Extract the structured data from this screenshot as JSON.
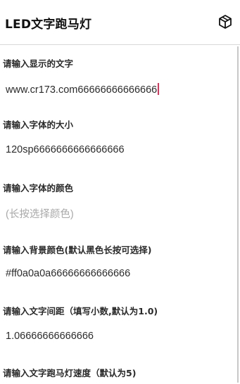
{
  "appbar": {
    "title": "LED文字跑马灯",
    "menu_icon": "cube-icon"
  },
  "fields": [
    {
      "label": "请输入显示的文字",
      "value": "www.cr173.com66666666666666",
      "placeholder": ""
    },
    {
      "label": "请输入字体的大小",
      "value": "120sp6666666666666666",
      "placeholder": ""
    },
    {
      "label": "请输入字体的颜色",
      "value": "",
      "placeholder": "(长按选择颜色)"
    },
    {
      "label": "请输入背景颜色(默认黑色长按可选择)",
      "value": "#ff0a0a0a66666666666666",
      "placeholder": ""
    },
    {
      "label": "请输入文字间距（填写小数,默认为1.0)",
      "value": "1.06666666666666",
      "placeholder": ""
    },
    {
      "label": "请输入文字跑马灯速度（默认为5)",
      "value": "",
      "placeholder": ""
    }
  ],
  "colors": {
    "caret": "#e0325a",
    "placeholder": "#a8a8a8",
    "divider": "#d8d8d8"
  }
}
